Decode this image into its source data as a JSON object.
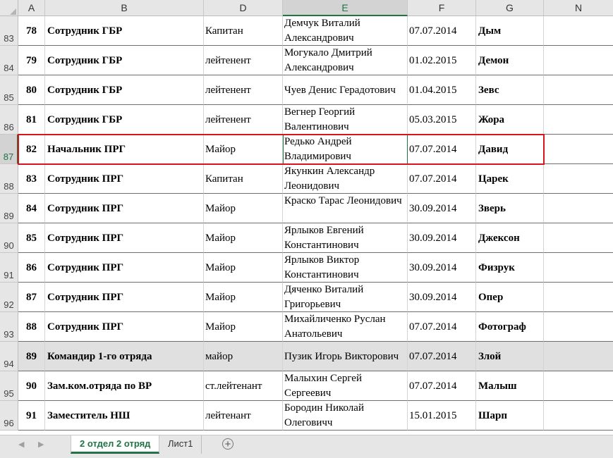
{
  "columns": {
    "A": "A",
    "B": "B",
    "D": "D",
    "E": "E",
    "F": "F",
    "G": "G",
    "N": "N"
  },
  "rows": [
    {
      "r": "83",
      "a": "78",
      "b": "Сотрудник ГБР",
      "d": "Капитан",
      "e": "Демчук Виталий Александрович",
      "f": "07.07.2014",
      "g": "Дым"
    },
    {
      "r": "84",
      "a": "79",
      "b": "Сотрудник ГБР",
      "d": "лейтенент",
      "e": "Могукало Дмитрий Александрович",
      "f": "01.02.2015",
      "g": "Демон"
    },
    {
      "r": "85",
      "a": "80",
      "b": "Сотрудник ГБР",
      "d": "лейтенент",
      "e": "Чуев Денис Герадотович",
      "f": "01.04.2015",
      "g": "Зевс"
    },
    {
      "r": "86",
      "a": "81",
      "b": "Сотрудник ГБР",
      "d": "лейтенент",
      "e": "Вегнер Георгий Валентинович",
      "f": "05.03.2015",
      "g": "Жора"
    },
    {
      "r": "87",
      "a": "82",
      "b": "Начальник ПРГ",
      "d": "Майор",
      "e": "Редько Андрей Владимирович",
      "f": "07.07.2014",
      "g": "Давид"
    },
    {
      "r": "88",
      "a": "83",
      "b": "Сотрудник ПРГ",
      "d": "Капитан",
      "e": "Якункин Александр Леонидович",
      "f": "07.07.2014",
      "g": "Царек"
    },
    {
      "r": "89",
      "a": "84",
      "b": "Сотрудник ПРГ",
      "d": "Майор",
      "e": "Краско Тарас Леонидович",
      "f": "30.09.2014",
      "g": "Зверь"
    },
    {
      "r": "90",
      "a": "85",
      "b": "Сотрудник ПРГ",
      "d": "Майор",
      "e": "Ярлыков Евгений Константинович",
      "f": "30.09.2014",
      "g": "Джексон"
    },
    {
      "r": "91",
      "a": "86",
      "b": "Сотрудник ПРГ",
      "d": "Майор",
      "e": "Ярлыков Виктор Константинович",
      "f": "30.09.2014",
      "g": "Физрук"
    },
    {
      "r": "92",
      "a": "87",
      "b": "Сотрудник ПРГ",
      "d": "Майор",
      "e": "Дяченко Виталий Григорьевич",
      "f": "30.09.2014",
      "g": "Опер"
    },
    {
      "r": "93",
      "a": "88",
      "b": "Сотрудник ПРГ",
      "d": "Майор",
      "e": "Михайличенко Руслан Анатольевич",
      "f": "07.07.2014",
      "g": "Фотограф"
    },
    {
      "r": "94",
      "a": "89",
      "b": "Командир  1-го отряда",
      "d": "майор",
      "e": "Пузик Игорь Викторович",
      "f": "07.07.2014",
      "g": "Злой"
    },
    {
      "r": "95",
      "a": "90",
      "b": "Зам.ком.отряда по ВР",
      "d": "ст.лейтенант",
      "e": "Малыхин Сергей Сергеевич",
      "f": "07.07.2014",
      "g": "Малыш"
    },
    {
      "r": "96",
      "a": "91",
      "b": "Заместитель НШ",
      "d": "лейтенант",
      "e": "Бородин Николай Олеговичч",
      "f": "15.01.2015",
      "g": "Шарп"
    }
  ],
  "tabs": {
    "active": "2 отдел 2 отряд",
    "other": "Лист1",
    "add_icon": "+"
  },
  "colors": {
    "accent": "#217346",
    "highlight": "#d9141b",
    "grey_row": "#e0e0e0"
  }
}
